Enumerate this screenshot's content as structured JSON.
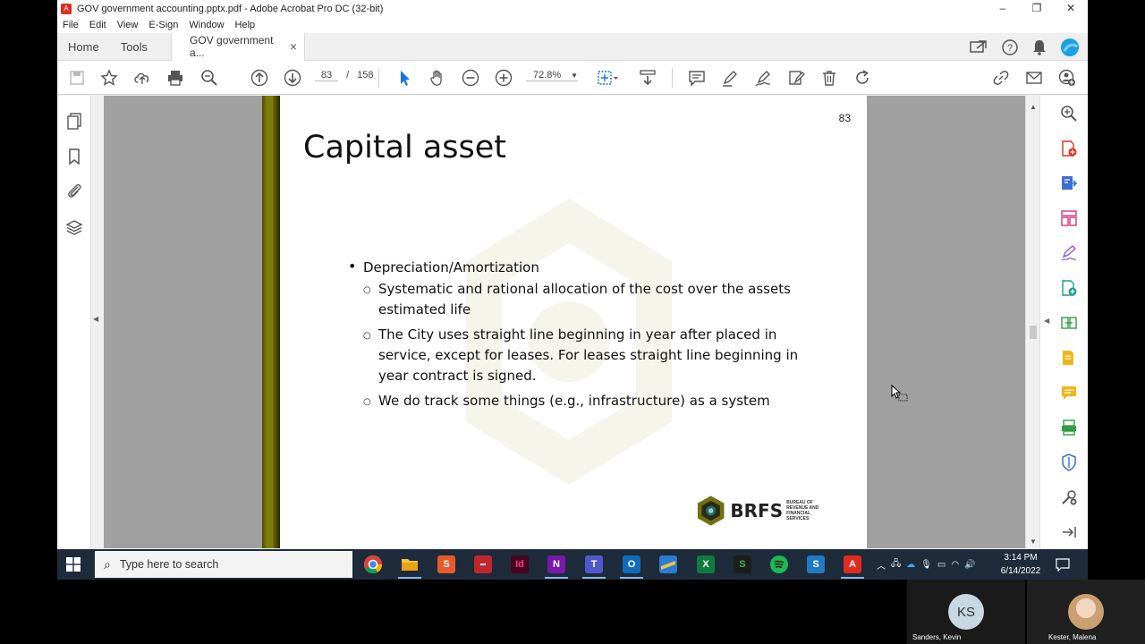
{
  "window": {
    "title": "GOV government accounting.pptx.pdf - Adobe Acrobat Pro DC (32-bit)",
    "controls": [
      "–",
      "❐",
      "✕"
    ]
  },
  "menu": [
    "File",
    "Edit",
    "View",
    "E-Sign",
    "Window",
    "Help"
  ],
  "tabs": {
    "home": "Home",
    "tools": "Tools",
    "document": "GOV government a...",
    "close": "×"
  },
  "toolbar": {
    "current_page": "83",
    "page_sep": "/",
    "total_pages": "158",
    "zoom": "72.8%"
  },
  "slide": {
    "page_number": "83",
    "title": "Capital asset",
    "bullet": "Depreciation/Amortization",
    "subbullets": [
      "Systematic and rational allocation of the cost over the assets estimated life",
      "The City uses straight line beginning in year after placed in service, except for leases.  For leases straight line beginning in year contract is signed.",
      "We do track some things (e.g., infrastructure) as a system"
    ],
    "logo_text": "BRFS",
    "logo_subtext": "BUREAU OF REVENUE AND FINANCIAL SERVICES"
  },
  "taskbar": {
    "search_placeholder": "Type here to search",
    "time": "3:14 PM",
    "date": "6/14/2022"
  },
  "participants": [
    {
      "initials": "KS",
      "name": "Sanders, Kevin"
    },
    {
      "name": "Kester, Malena"
    }
  ],
  "colors": {
    "accent_blue": "#1473e6",
    "acrobat_red": "#e02c1e",
    "taskbar": "#1e2b3a",
    "slide_bar": "#7d7d05"
  }
}
